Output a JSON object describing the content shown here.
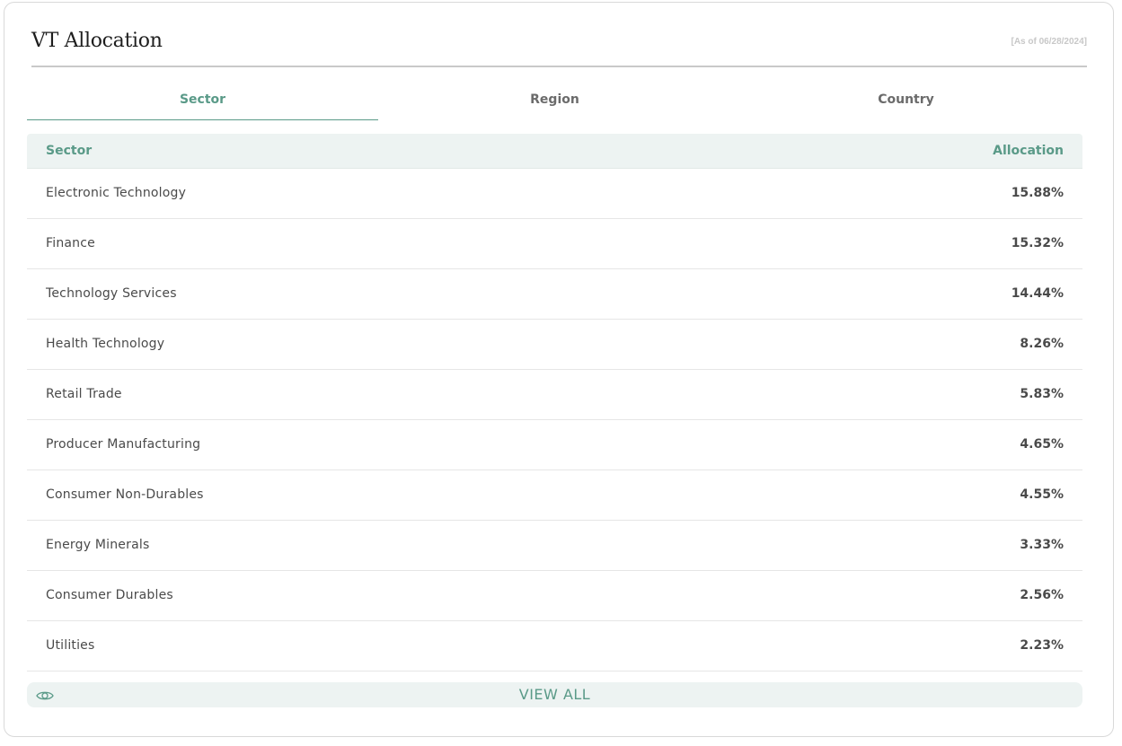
{
  "header": {
    "title": "VT Allocation",
    "as_of": "[As of 06/28/2024]"
  },
  "tabs": [
    {
      "label": "Sector",
      "active": true
    },
    {
      "label": "Region",
      "active": false
    },
    {
      "label": "Country",
      "active": false
    }
  ],
  "table": {
    "columns": [
      "Sector",
      "Allocation"
    ],
    "rows": [
      {
        "name": "Electronic Technology",
        "value": "15.88%"
      },
      {
        "name": "Finance",
        "value": "15.32%"
      },
      {
        "name": "Technology Services",
        "value": "14.44%"
      },
      {
        "name": "Health Technology",
        "value": "8.26%"
      },
      {
        "name": "Retail Trade",
        "value": "5.83%"
      },
      {
        "name": "Producer Manufacturing",
        "value": "4.65%"
      },
      {
        "name": "Consumer Non-Durables",
        "value": "4.55%"
      },
      {
        "name": "Energy Minerals",
        "value": "3.33%"
      },
      {
        "name": "Consumer Durables",
        "value": "2.56%"
      },
      {
        "name": "Utilities",
        "value": "2.23%"
      }
    ]
  },
  "view_all": {
    "label": "VIEW ALL",
    "icon": "eye-icon"
  },
  "colors": {
    "accent": "#5a9a88",
    "header_bg": "#edf3f2"
  }
}
